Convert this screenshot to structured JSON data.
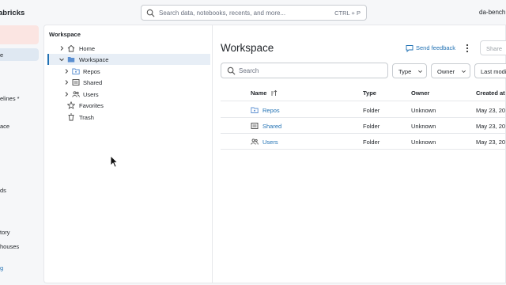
{
  "topbar": {
    "brand": "abricks",
    "search_placeholder": "Search data, notebooks, recents, and more...",
    "search_shortcut": "CTRL + P",
    "user": "da-bench"
  },
  "leftnav": {
    "items": [
      {
        "label": "e"
      },
      {
        "label": "elines *"
      },
      {
        "label": "ace"
      },
      {
        "label": "ds"
      },
      {
        "label": "tory"
      },
      {
        "label": "houses"
      },
      {
        "label": "g"
      }
    ]
  },
  "tree": {
    "title": "Workspace",
    "items": [
      {
        "label": "Home",
        "icon": "home-icon"
      },
      {
        "label": "Workspace",
        "icon": "folder-icon"
      },
      {
        "label": "Repos",
        "icon": "repo-folder-icon"
      },
      {
        "label": "Shared",
        "icon": "shared-folder-icon"
      },
      {
        "label": "Users",
        "icon": "users-icon"
      },
      {
        "label": "Favorites",
        "icon": "star-icon"
      },
      {
        "label": "Trash",
        "icon": "trash-icon"
      }
    ]
  },
  "main": {
    "title": "Workspace",
    "feedback": "Send feedback",
    "share": "Share",
    "search_placeholder": "Search",
    "filters": [
      "Type",
      "Owner",
      "Last modi"
    ],
    "columns": [
      "Name",
      "Type",
      "Owner",
      "Created at"
    ],
    "rows": [
      {
        "name": "Repos",
        "type": "Folder",
        "owner": "Unknown",
        "created": "May 23, 20"
      },
      {
        "name": "Shared",
        "type": "Folder",
        "owner": "Unknown",
        "created": "May 23, 20"
      },
      {
        "name": "Users",
        "type": "Folder",
        "owner": "Unknown",
        "created": "May 23, 20"
      }
    ]
  },
  "colors": {
    "accent": "#2272b4",
    "selected_bg": "#e7eef6",
    "new_button_bg": "#fbe5e2"
  }
}
